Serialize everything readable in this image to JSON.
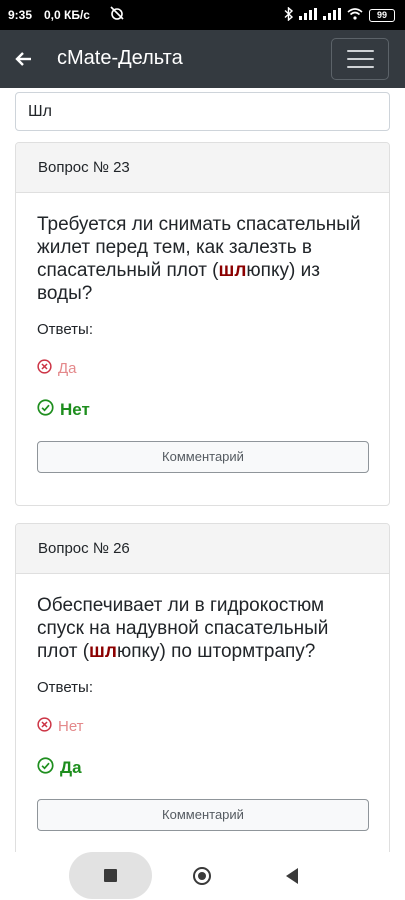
{
  "status_bar": {
    "time": "9:35",
    "speed": "0,0 КБ/с",
    "battery": "99"
  },
  "app_bar": {
    "title": "cMate-Дельта",
    "back_icon": "arrow-left-icon",
    "menu_icon": "hamburger-menu-icon"
  },
  "search": {
    "value": "Шл"
  },
  "questions": [
    {
      "header": "Вопрос № 23",
      "text_before": "Требуется ли снимать спасательный жилет перед тем, как залезть в спасательный плот (",
      "highlight": "шл",
      "text_after": "юпку) из воды?",
      "answers_label": "Ответы:",
      "wrong_answer": "Да",
      "right_answer": "Нет",
      "comment_label": "Комментарий"
    },
    {
      "header": "Вопрос № 26",
      "text_before": "Обеспечивает ли в гидрокостюм спуск на надувной спасательный плот (",
      "highlight": "шл",
      "text_after": "юпку) по штормтрапу?",
      "answers_label": "Ответы:",
      "wrong_answer": "Нет",
      "right_answer": "Да",
      "comment_label": "Комментарий"
    }
  ],
  "colors": {
    "app_bar": "#343a40",
    "highlight": "#8b0000",
    "correct": "#1e8e1e",
    "incorrect": "#e4898b"
  }
}
